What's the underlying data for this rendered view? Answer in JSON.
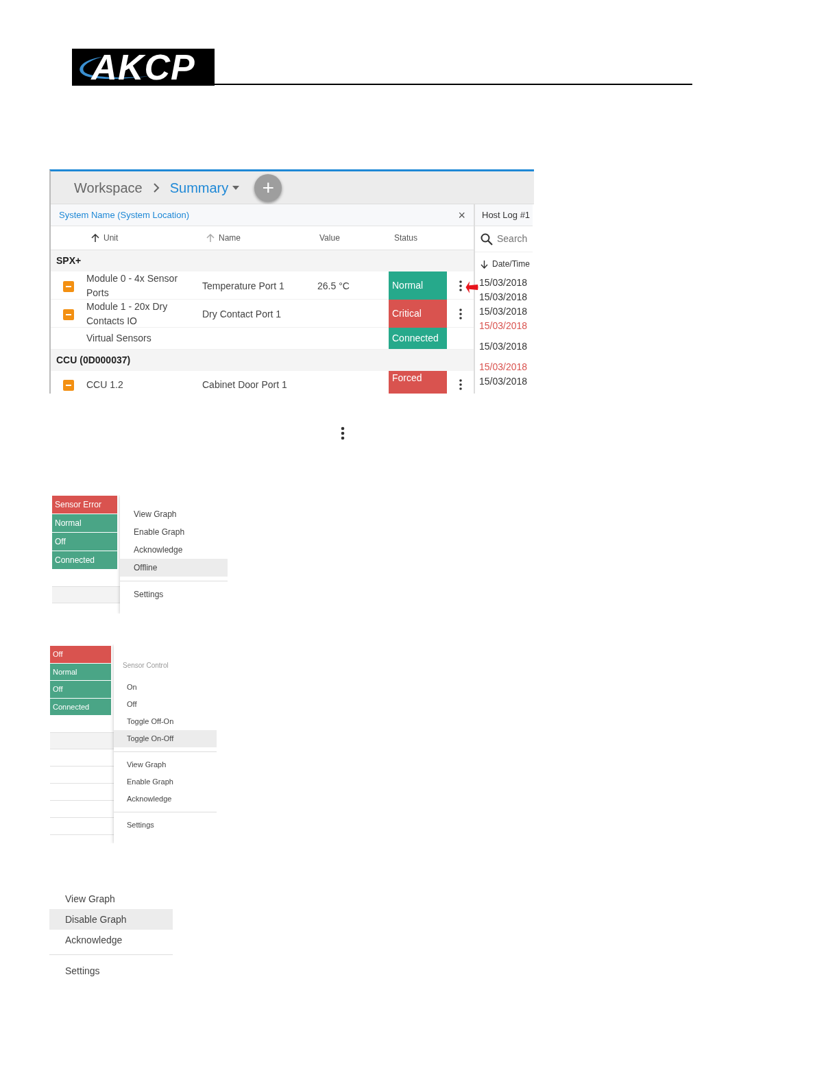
{
  "logo": {
    "text": "AKCP"
  },
  "summary_screen": {
    "breadcrumb": [
      {
        "label": "Workspace",
        "current": false
      },
      {
        "label": "Summary",
        "current": true
      }
    ],
    "add_button": "+",
    "panel_title": "System Name (System Location)",
    "close_button": "×",
    "columns": [
      {
        "label": "Unit",
        "sort_active": true
      },
      {
        "label": "Name",
        "sort_active": false
      },
      {
        "label": "Value"
      },
      {
        "label": "Status"
      }
    ],
    "groups": [
      {
        "name": "SPX+",
        "rows": [
          {
            "unit": "Module 0 - 4x Sensor Ports",
            "name": "Temperature Port 1",
            "value": "26.5 °C",
            "status": "Normal",
            "color": "#26a98b",
            "collapse_icon": true,
            "menu": true
          },
          {
            "unit": "Module 1 - 20x Dry Contacts IO",
            "name": "Dry Contact Port 1",
            "value": "",
            "status": "Critical",
            "color": "#d9534f",
            "collapse_icon": true,
            "menu": true
          },
          {
            "unit": "Virtual Sensors",
            "name": "",
            "value": "",
            "status": "Connected",
            "color": "#26a98b",
            "collapse_icon": false,
            "menu": false
          }
        ]
      },
      {
        "name": "CCU (0D000037)",
        "rows": [
          {
            "unit": "CCU 1.2",
            "name": "Cabinet Door Port 1",
            "value": "",
            "status": "Forced",
            "color": "#d9534f",
            "collapse_icon": true,
            "menu": true
          }
        ]
      }
    ],
    "host_log": {
      "title": "Host Log #1",
      "placeholder": "Search",
      "column": "Date/Time",
      "entries": [
        {
          "text": "15/03/2018",
          "alert": false
        },
        {
          "text": "15/03/2018",
          "alert": false
        },
        {
          "text": "15/03/2018",
          "alert": false
        },
        {
          "text": "15/03/2018",
          "alert": true
        },
        {
          "text": "15/03/2018",
          "alert": false
        },
        {
          "text": "15/03/2018",
          "alert": true
        },
        {
          "text": "15/03/2018",
          "alert": false
        }
      ]
    },
    "pointer_arrow": true
  },
  "context_menus": [
    {
      "statuses": [
        {
          "text": "Sensor Error",
          "color": "#d9534f"
        },
        {
          "text": "Normal",
          "color": "#4aa586"
        },
        {
          "text": "Off",
          "color": "#4aa586"
        },
        {
          "text": "Connected",
          "color": "#4aa586"
        }
      ],
      "items": [
        {
          "kind": "item",
          "label": "View Graph",
          "selected": false
        },
        {
          "kind": "item",
          "label": "Enable Graph",
          "selected": false
        },
        {
          "kind": "item",
          "label": "Acknowledge",
          "selected": false
        },
        {
          "kind": "item",
          "label": "Offline",
          "selected": true
        },
        {
          "kind": "divider"
        },
        {
          "kind": "item",
          "label": "Settings",
          "selected": false
        }
      ]
    },
    {
      "statuses": [
        {
          "text": "Off",
          "color": "#d9534f"
        },
        {
          "text": "Normal",
          "color": "#4aa586"
        },
        {
          "text": "Off",
          "color": "#4aa586"
        },
        {
          "text": "Connected",
          "color": "#4aa586"
        }
      ],
      "items": [
        {
          "kind": "header",
          "label": "Sensor Control"
        },
        {
          "kind": "item",
          "label": "On",
          "selected": false
        },
        {
          "kind": "item",
          "label": "Off",
          "selected": false
        },
        {
          "kind": "item",
          "label": "Toggle Off-On",
          "selected": false
        },
        {
          "kind": "item",
          "label": "Toggle On-Off",
          "selected": true
        },
        {
          "kind": "divider"
        },
        {
          "kind": "item",
          "label": "View Graph",
          "selected": false
        },
        {
          "kind": "item",
          "label": "Enable Graph",
          "selected": false
        },
        {
          "kind": "item",
          "label": "Acknowledge",
          "selected": false
        },
        {
          "kind": "divider"
        },
        {
          "kind": "item",
          "label": "Settings",
          "selected": false
        }
      ]
    },
    {
      "items": [
        {
          "kind": "item",
          "label": "View Graph",
          "selected": false
        },
        {
          "kind": "item",
          "label": "Disable Graph",
          "selected": true
        },
        {
          "kind": "item",
          "label": "Acknowledge",
          "selected": false
        },
        {
          "kind": "divider"
        },
        {
          "kind": "item",
          "label": "Settings",
          "selected": false
        }
      ]
    }
  ]
}
